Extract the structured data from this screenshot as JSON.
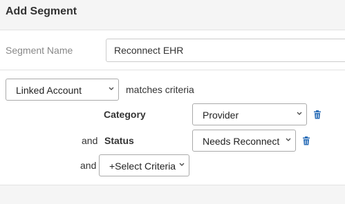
{
  "dialog": {
    "title": "Add Segment"
  },
  "segment_name": {
    "label": "Segment Name",
    "value": "Reconnect EHR"
  },
  "rule": {
    "account_select": "Linked Account",
    "matches_text": "matches criteria",
    "criteria": [
      {
        "conjunction": "",
        "label": "Category",
        "value": "Provider"
      },
      {
        "conjunction": "and",
        "label": "Status",
        "value": "Needs Reconnect"
      }
    ],
    "add_conjunction": "and",
    "add_select": "+Select Criteria"
  },
  "colors": {
    "trash_icon": "#2c6fb8",
    "header_bg": "#f5f5f5",
    "border": "#e3e3e3"
  }
}
